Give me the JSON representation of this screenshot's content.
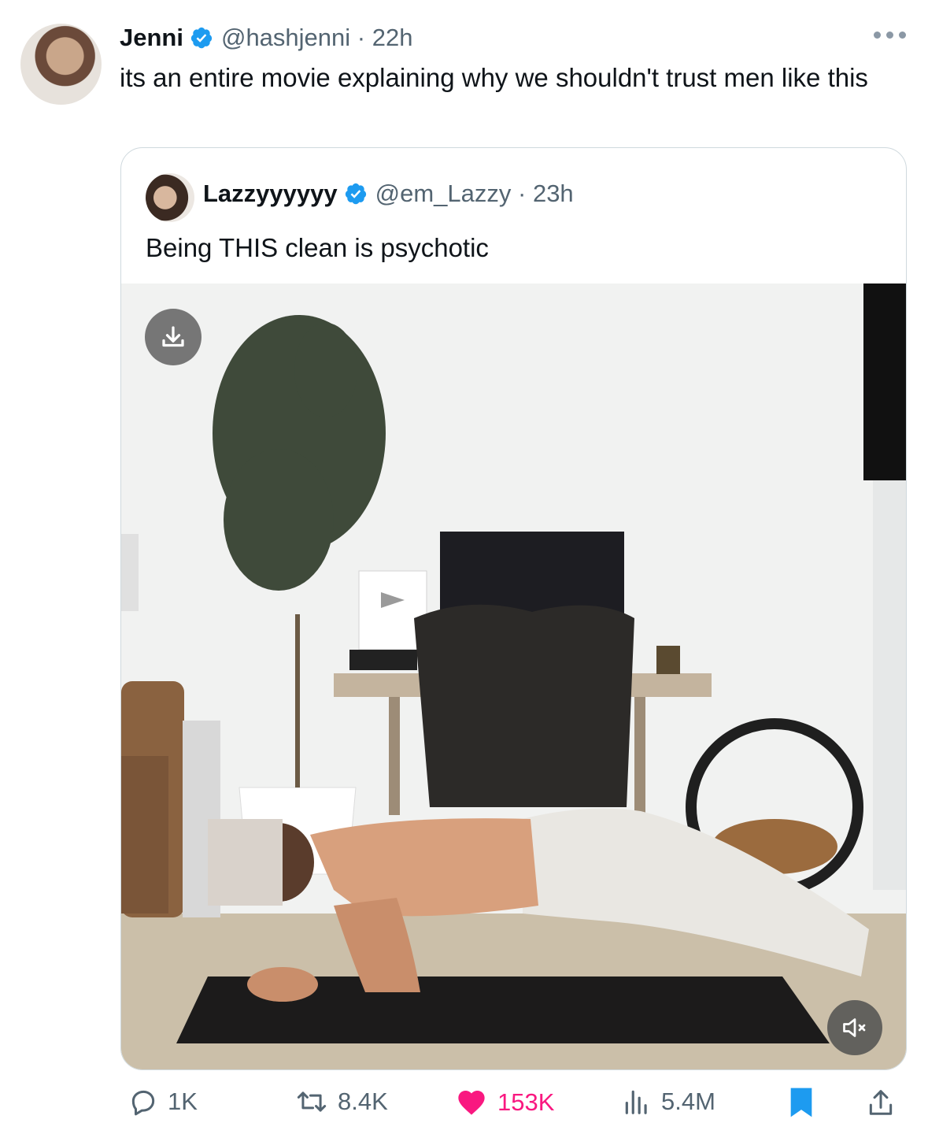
{
  "tweet": {
    "author_name": "Jenni",
    "handle": "@hashjenni",
    "time": "22h",
    "text": "its an entire movie explaining why we shouldn't trust men like this"
  },
  "quoted": {
    "author_name": "Lazzyyyyyy",
    "handle": "@em_Lazzy",
    "time": "23h",
    "text": "Being THIS clean is psychotic"
  },
  "actions": {
    "replies": "1K",
    "reposts": "8.4K",
    "likes": "153K",
    "views": "5.4M"
  },
  "icons": {
    "verified": "verified-badge-icon",
    "more": "more-icon",
    "download": "download-icon",
    "mute": "mute-icon",
    "reply": "reply-icon",
    "repost": "repost-icon",
    "like": "heart-icon",
    "views": "views-icon",
    "bookmark": "bookmark-icon",
    "share": "share-icon"
  },
  "colors": {
    "verified": "#1d9bf0",
    "like": "#f91880",
    "bookmark": "#1d9bf0",
    "meta": "#536471"
  }
}
